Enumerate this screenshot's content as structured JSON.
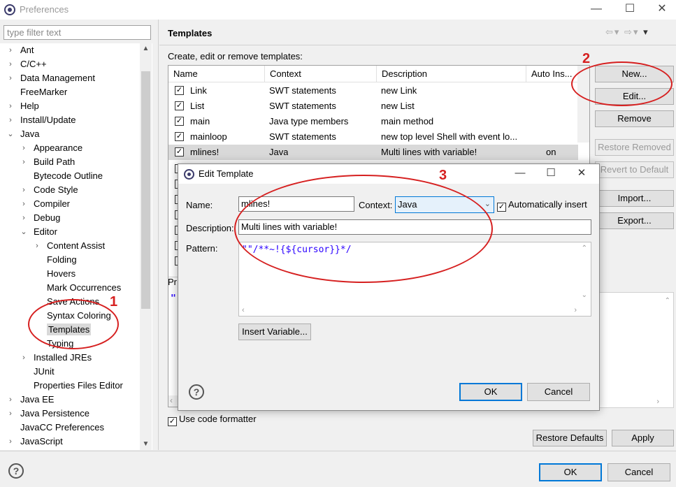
{
  "window": {
    "title": "Preferences",
    "controls": [
      "minimize-icon",
      "maximize-icon",
      "close-icon"
    ]
  },
  "sidebar": {
    "filter_placeholder": "type filter text",
    "items": [
      {
        "label": "Ant",
        "level": 0,
        "expander": "collapsed"
      },
      {
        "label": "C/C++",
        "level": 0,
        "expander": "collapsed"
      },
      {
        "label": "Data Management",
        "level": 0,
        "expander": "collapsed"
      },
      {
        "label": "FreeMarker",
        "level": 0,
        "expander": "none"
      },
      {
        "label": "Help",
        "level": 0,
        "expander": "collapsed"
      },
      {
        "label": "Install/Update",
        "level": 0,
        "expander": "collapsed"
      },
      {
        "label": "Java",
        "level": 0,
        "expander": "expanded"
      },
      {
        "label": "Appearance",
        "level": 1,
        "expander": "collapsed"
      },
      {
        "label": "Build Path",
        "level": 1,
        "expander": "collapsed"
      },
      {
        "label": "Bytecode Outline",
        "level": 1,
        "expander": "none"
      },
      {
        "label": "Code Style",
        "level": 1,
        "expander": "collapsed"
      },
      {
        "label": "Compiler",
        "level": 1,
        "expander": "collapsed"
      },
      {
        "label": "Debug",
        "level": 1,
        "expander": "collapsed"
      },
      {
        "label": "Editor",
        "level": 1,
        "expander": "expanded"
      },
      {
        "label": "Content Assist",
        "level": 2,
        "expander": "collapsed"
      },
      {
        "label": "Folding",
        "level": 2,
        "expander": "none"
      },
      {
        "label": "Hovers",
        "level": 2,
        "expander": "none"
      },
      {
        "label": "Mark Occurrences",
        "level": 2,
        "expander": "none"
      },
      {
        "label": "Save Actions",
        "level": 2,
        "expander": "none"
      },
      {
        "label": "Syntax Coloring",
        "level": 2,
        "expander": "none"
      },
      {
        "label": "Templates",
        "level": 2,
        "expander": "none",
        "selected": true
      },
      {
        "label": "Typing",
        "level": 2,
        "expander": "none"
      },
      {
        "label": "Installed JREs",
        "level": 1,
        "expander": "collapsed"
      },
      {
        "label": "JUnit",
        "level": 1,
        "expander": "none"
      },
      {
        "label": "Properties Files Editor",
        "level": 1,
        "expander": "none"
      },
      {
        "label": "Java EE",
        "level": 0,
        "expander": "collapsed"
      },
      {
        "label": "Java Persistence",
        "level": 0,
        "expander": "collapsed"
      },
      {
        "label": "JavaCC Preferences",
        "level": 0,
        "expander": "none"
      },
      {
        "label": "JavaScript",
        "level": 0,
        "expander": "collapsed"
      }
    ]
  },
  "page": {
    "title": "Templates",
    "intro": "Create, edit or remove templates:",
    "columns": [
      "Name",
      "Context",
      "Description",
      "Auto Ins..."
    ],
    "rows": [
      {
        "checked": true,
        "name": "Link",
        "context": "SWT statements",
        "description": "new Link",
        "auto": ""
      },
      {
        "checked": true,
        "name": "List",
        "context": "SWT statements",
        "description": "new List",
        "auto": ""
      },
      {
        "checked": true,
        "name": "main",
        "context": "Java type members",
        "description": "main method",
        "auto": ""
      },
      {
        "checked": true,
        "name": "mainloop",
        "context": "SWT statements",
        "description": "new top level Shell with event lo...",
        "auto": ""
      },
      {
        "checked": true,
        "name": "mlines!",
        "context": "Java",
        "description": "Multi lines with variable!",
        "auto": "on",
        "selected": true
      }
    ],
    "buttons": {
      "new": "New...",
      "edit": "Edit...",
      "remove": "Remove",
      "restore_removed": "Restore Removed",
      "revert_default": "Revert to Default",
      "import": "Import...",
      "export": "Export..."
    },
    "preview_label": "Pr",
    "preview_char": "\"",
    "use_formatter": "Use code formatter",
    "restore_defaults": "Restore Defaults",
    "apply": "Apply"
  },
  "footer": {
    "ok": "OK",
    "cancel": "Cancel"
  },
  "dialog": {
    "title": "Edit Template",
    "name_label": "Name:",
    "name_value": "mlines!",
    "context_label": "Context:",
    "context_value": "Java",
    "auto_insert_label": "Automatically insert",
    "description_label": "Description:",
    "description_value": "Multi lines with variable!",
    "pattern_label": "Pattern:",
    "pattern_value": "\"\"/**~!{${cursor}}*/",
    "insert_variable": "Insert Variable...",
    "ok": "OK",
    "cancel": "Cancel"
  },
  "annotations": {
    "one": "1",
    "two": "2",
    "three": "3",
    "color": "#d62020"
  }
}
